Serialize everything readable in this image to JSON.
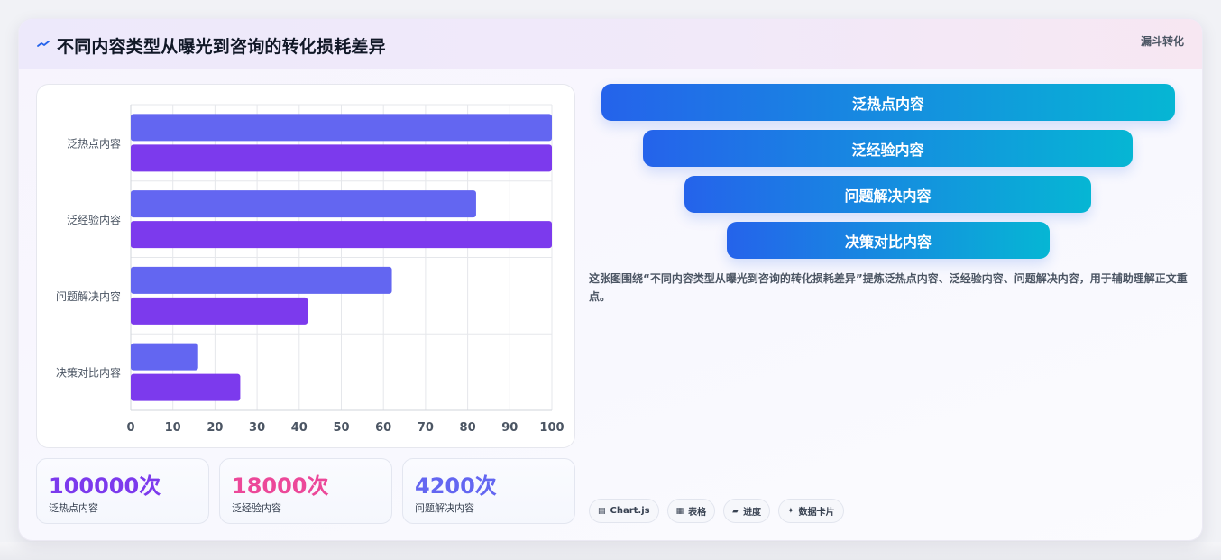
{
  "header": {
    "title": "不同内容类型从曝光到咨询的转化损耗差异",
    "tag": "漏斗转化",
    "icon": "wave-line-icon"
  },
  "chart_data": {
    "type": "bar",
    "orientation": "horizontal",
    "categories": [
      "泛热点内容",
      "泛经验内容",
      "问题解决内容",
      "决策对比内容"
    ],
    "series": [
      {
        "values": [
          100,
          82,
          62,
          16
        ],
        "color": "#6366f1"
      },
      {
        "values": [
          100,
          100,
          42,
          26
        ],
        "color": "#7c3aed"
      }
    ],
    "xlim": [
      0,
      100
    ],
    "xticks": [
      0,
      10,
      20,
      30,
      40,
      50,
      60,
      70,
      80,
      90,
      100
    ],
    "grid": true,
    "legend": "none"
  },
  "stats": [
    {
      "value": "100000次",
      "label": "泛热点内容",
      "color": "#7c3aed"
    },
    {
      "value": "18000次",
      "label": "泛经验内容",
      "color": "#ec4899"
    },
    {
      "value": "4200次",
      "label": "问题解决内容",
      "color": "#6366f1"
    }
  ],
  "funnel": {
    "stages": [
      "泛热点内容",
      "泛经验内容",
      "问题解决内容",
      "决策对比内容"
    ],
    "gradient": [
      "#2563eb",
      "#06b6d4"
    ]
  },
  "description": "这张图围绕“不同内容类型从曝光到咨询的转化损耗差异”提炼泛热点内容、泛经验内容、问题解决内容，用于辅助理解正文重点。",
  "chips": [
    {
      "icon": "chart-icon",
      "glyph": "▤",
      "label": "Chart.js"
    },
    {
      "icon": "table-icon",
      "glyph": "▦",
      "label": "表格"
    },
    {
      "icon": "progress-icon",
      "glyph": "▰",
      "label": "进度"
    },
    {
      "icon": "sparkle-icon",
      "glyph": "✦",
      "label": "数据卡片"
    }
  ]
}
